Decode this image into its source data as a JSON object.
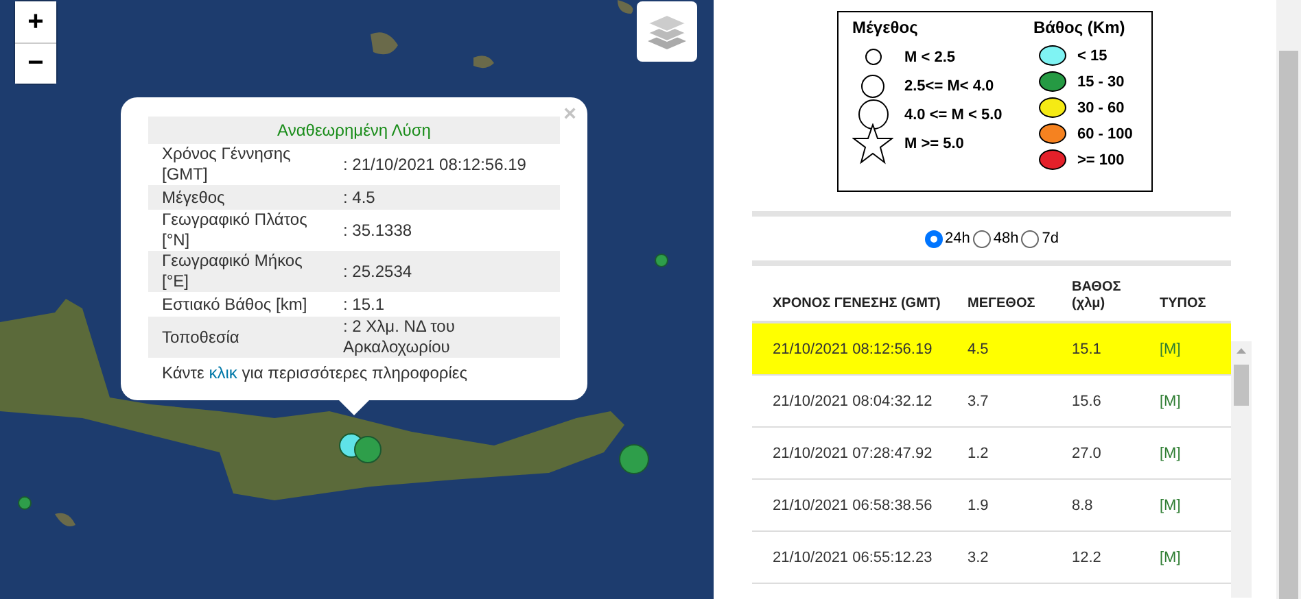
{
  "map": {
    "zoom_in": "+",
    "zoom_out": "−",
    "markers": [
      {
        "color": "#5fe3e8"
      },
      {
        "color": "#2e9e4a"
      },
      {
        "color": "#2e9e4a"
      },
      {
        "color": "#2e9e4a"
      },
      {
        "color": "#2e9e4a"
      }
    ],
    "popup": {
      "close": "×",
      "title": "Αναθεωρημένη Λύση",
      "rows": [
        {
          "label": "Χρόνος Γέννησης [GMT]",
          "value": ": 21/10/2021 08:12:56.19"
        },
        {
          "label": "Μέγεθος",
          "value": ": 4.5"
        },
        {
          "label": "Γεωγραφικό Πλάτος [°N]",
          "value": ": 35.1338"
        },
        {
          "label": "Γεωγραφικό Μήκος [°E]",
          "value": ": 25.2534"
        },
        {
          "label": "Εστιακό Βάθος [km]",
          "value": ": 15.1"
        },
        {
          "label": "Τοποθεσία",
          "value": ": 2 Χλμ. ΝΔ του Αρκαλοχωρίου"
        }
      ],
      "footer_before": "Κάντε",
      "link": "κλικ",
      "footer_after": "για περισσότερες πληροφορίες"
    }
  },
  "legend": {
    "magnitude_title": "Μέγεθος",
    "depth_title": "Βάθος (Km)",
    "magnitude_items": [
      {
        "kind": "small",
        "label": "M < 2.5"
      },
      {
        "kind": "medium",
        "label": "2.5<= M< 4.0"
      },
      {
        "kind": "large",
        "label": "4.0 <= M < 5.0"
      },
      {
        "kind": "star",
        "label": "M >= 5.0"
      }
    ],
    "depth_items": [
      {
        "color": "#7ff3f3",
        "label": "< 15"
      },
      {
        "color": "#259a43",
        "label": "15 - 30"
      },
      {
        "color": "#f5ea14",
        "label": "30 - 60"
      },
      {
        "color": "#f58220",
        "label": "60 - 100"
      },
      {
        "color": "#e3202a",
        "label": ">= 100"
      }
    ]
  },
  "period": [
    {
      "label": "24h",
      "selected": true
    },
    {
      "label": "48h",
      "selected": false
    },
    {
      "label": "7d",
      "selected": false
    }
  ],
  "table": {
    "columns": [
      "ΧΡΟΝΟΣ ΓΕΝΕΣΗΣ (GMT)",
      "ΜΕΓΕΘΟΣ",
      "ΒΑΘΟΣ (χλμ)",
      "ΤΥΠΟΣ"
    ],
    "rows": [
      {
        "selected": true,
        "cells": [
          "21/10/2021 08:12:56.19",
          "4.5",
          "15.1",
          "[M]"
        ]
      },
      {
        "selected": false,
        "cells": [
          "21/10/2021 08:04:32.12",
          "3.7",
          "15.6",
          "[M]"
        ]
      },
      {
        "selected": false,
        "cells": [
          "21/10/2021 07:28:47.92",
          "1.2",
          "27.0",
          "[M]"
        ]
      },
      {
        "selected": false,
        "cells": [
          "21/10/2021 06:58:38.56",
          "1.9",
          "8.8",
          "[M]"
        ]
      },
      {
        "selected": false,
        "cells": [
          "21/10/2021 06:55:12.23",
          "3.2",
          "12.2",
          "[M]"
        ]
      }
    ]
  }
}
